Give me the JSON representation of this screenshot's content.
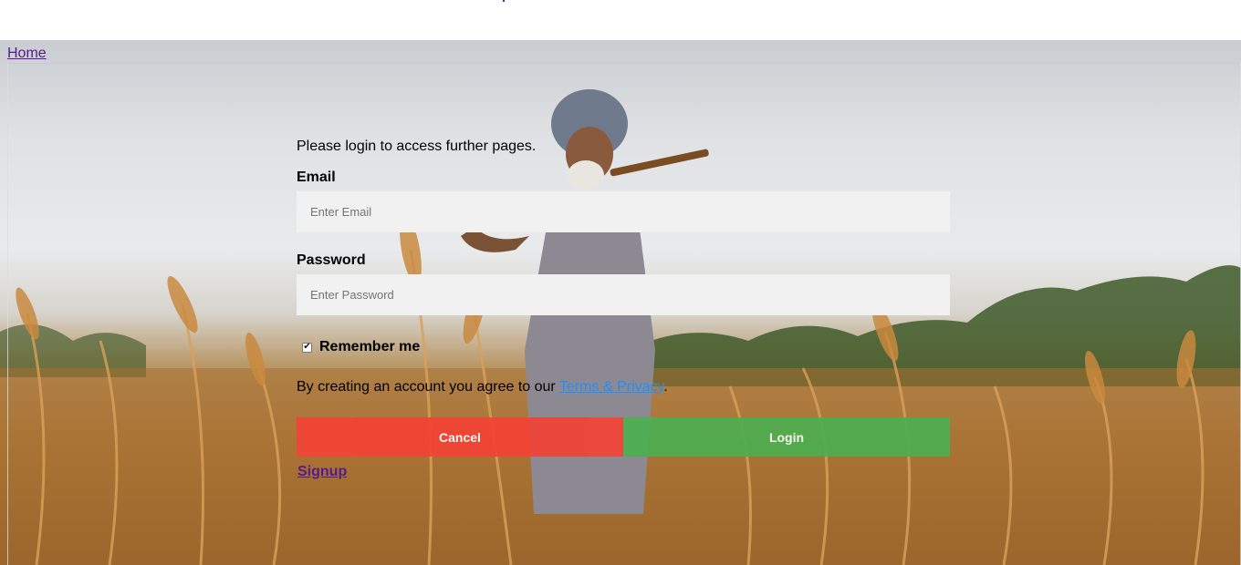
{
  "nav": {
    "home_label": "Home"
  },
  "form": {
    "intro": "Please login to access further pages.",
    "email_label": "Email",
    "email_placeholder": "Enter Email",
    "email_value": "",
    "password_label": "Password",
    "password_placeholder": "Enter Password",
    "password_value": "",
    "remember_label": "Remember me",
    "remember_checked": true,
    "terms_prefix": "By creating an account you agree to our ",
    "terms_link": "Terms & Privacy",
    "terms_suffix": ".",
    "cancel_label": "Cancel",
    "login_label": "Login",
    "signup_label": "Signup"
  },
  "colors": {
    "cancel": "#f44336",
    "login": "#4caf50",
    "link": "#1e90ff",
    "visited_link": "#551a8b",
    "field_bg": "#f1f1f1"
  },
  "icons": {
    "checkbox": "check-icon"
  },
  "background": {
    "image": "farmer in wheat field photo"
  }
}
